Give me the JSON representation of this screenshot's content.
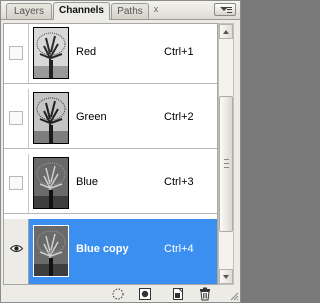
{
  "tabs": [
    {
      "label": "Layers",
      "active": false
    },
    {
      "label": "Channels",
      "active": true
    },
    {
      "label": "Paths",
      "active": false
    }
  ],
  "tab_close_glyph": "x",
  "channels": [
    {
      "name": "Red",
      "shortcut": "Ctrl+1",
      "visible": false,
      "selected": false,
      "thumb_tone": "light"
    },
    {
      "name": "Green",
      "shortcut": "Ctrl+2",
      "visible": false,
      "selected": false,
      "thumb_tone": "medium"
    },
    {
      "name": "Blue",
      "shortcut": "Ctrl+3",
      "visible": false,
      "selected": false,
      "thumb_tone": "dark"
    },
    {
      "name": "Blue copy",
      "shortcut": "Ctrl+4",
      "visible": true,
      "selected": true,
      "thumb_tone": "dark"
    }
  ],
  "toolbar_icons": [
    "load-channel-as-selection-icon",
    "save-selection-as-channel-icon",
    "create-new-channel-icon",
    "delete-channel-icon"
  ],
  "colors": {
    "selection": "#3b8ff0",
    "panel": "#ecebe6"
  }
}
